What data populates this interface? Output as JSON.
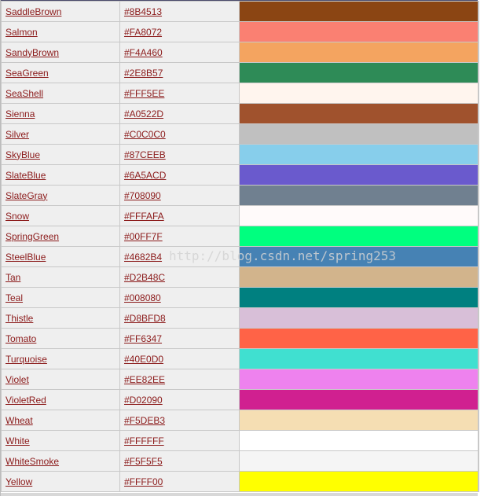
{
  "watermark": "http://blog.csdn.net/spring253",
  "colors": [
    {
      "name": "SaddleBrown",
      "hex": "#8B4513"
    },
    {
      "name": "Salmon",
      "hex": "#FA8072"
    },
    {
      "name": "SandyBrown",
      "hex": "#F4A460"
    },
    {
      "name": "SeaGreen",
      "hex": "#2E8B57"
    },
    {
      "name": "SeaShell",
      "hex": "#FFF5EE"
    },
    {
      "name": "Sienna",
      "hex": "#A0522D"
    },
    {
      "name": "Silver",
      "hex": "#C0C0C0"
    },
    {
      "name": "SkyBlue",
      "hex": "#87CEEB"
    },
    {
      "name": "SlateBlue",
      "hex": "#6A5ACD"
    },
    {
      "name": "SlateGray",
      "hex": "#708090"
    },
    {
      "name": "Snow",
      "hex": "#FFFAFA"
    },
    {
      "name": "SpringGreen",
      "hex": "#00FF7F"
    },
    {
      "name": "SteelBlue",
      "hex": "#4682B4"
    },
    {
      "name": "Tan",
      "hex": "#D2B48C"
    },
    {
      "name": "Teal",
      "hex": "#008080"
    },
    {
      "name": "Thistle",
      "hex": "#D8BFD8"
    },
    {
      "name": "Tomato",
      "hex": "#FF6347"
    },
    {
      "name": "Turquoise",
      "hex": "#40E0D0"
    },
    {
      "name": "Violet",
      "hex": "#EE82EE"
    },
    {
      "name": "VioletRed",
      "hex": "#D02090"
    },
    {
      "name": "Wheat",
      "hex": "#F5DEB3"
    },
    {
      "name": "White",
      "hex": "#FFFFFF"
    },
    {
      "name": "WhiteSmoke",
      "hex": "#F5F5F5"
    },
    {
      "name": "Yellow",
      "hex": "#FFFF00"
    }
  ]
}
